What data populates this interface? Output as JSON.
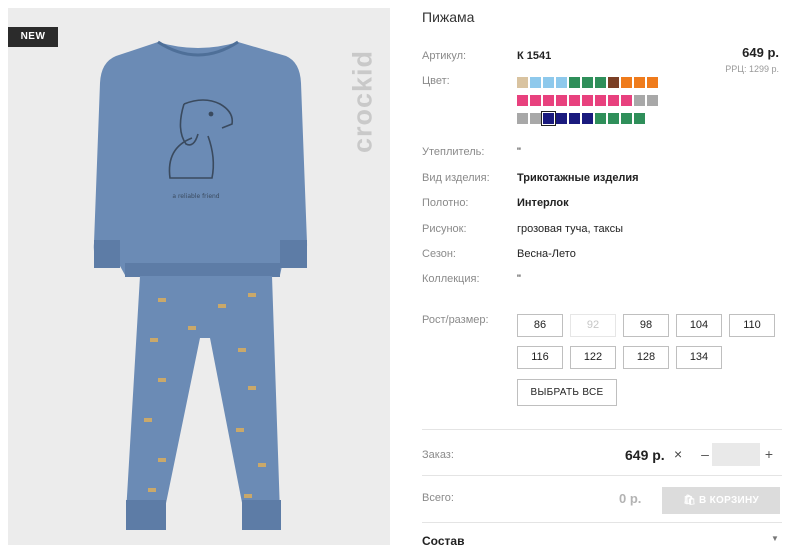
{
  "badge": "NEW",
  "brand": "crockid",
  "title": "Пижама",
  "article": {
    "label": "Артикул:",
    "value": "К 1541"
  },
  "price": {
    "value": "649 р.",
    "rrp": "РРЦ: 1299 р."
  },
  "color": {
    "label": "Цвет:",
    "swatches": [
      "#d9c3a0",
      "#8ec9ec",
      "#8ec9ec",
      "#8ec9ec",
      "#2f8f5a",
      "#2f8f5a",
      "#2f8f5a",
      "#7b3f25",
      "#ef7b1c",
      "#ef7b1c",
      "#ef7b1c",
      "#e8417e",
      "#e8417e",
      "#e8417e",
      "#e8417e",
      "#e8417e",
      "#e8417e",
      "#e8417e",
      "#e8417e",
      "#e8417e",
      "#a8a8a8",
      "#a8a8a8",
      "#a8a8a8",
      "#a8a8a8",
      "#1a1a7e",
      "#1a1a7e",
      "#1a1a7e",
      "#1a1a7e",
      "#2f8f5a",
      "#2f8f5a",
      "#2f8f5a",
      "#2f8f5a"
    ],
    "selected_index": 24
  },
  "props": [
    {
      "label": "Утеплитель:",
      "value": "\"",
      "bold": false
    },
    {
      "label": "Вид изделия:",
      "value": "Трикотажные изделия",
      "bold": true
    },
    {
      "label": "Полотно:",
      "value": "Интерлок",
      "bold": true
    },
    {
      "label": "Рисунок:",
      "value": "грозовая туча, таксы",
      "bold": false
    },
    {
      "label": "Сезон:",
      "value": "Весна-Лето",
      "bold": false
    },
    {
      "label": "Коллекция:",
      "value": "\"",
      "bold": false
    }
  ],
  "size": {
    "label": "Рост/размер:",
    "items": [
      {
        "label": "86",
        "disabled": false
      },
      {
        "label": "92",
        "disabled": true
      },
      {
        "label": "98",
        "disabled": false
      },
      {
        "label": "104",
        "disabled": false
      },
      {
        "label": "110",
        "disabled": false
      },
      {
        "label": "116",
        "disabled": false
      },
      {
        "label": "122",
        "disabled": false
      },
      {
        "label": "128",
        "disabled": false
      },
      {
        "label": "134",
        "disabled": false
      }
    ],
    "select_all": "ВЫБРАТЬ ВСЕ"
  },
  "order": {
    "label": "Заказ:",
    "price": "649 р.",
    "times": "×",
    "minus": "–",
    "plus": "+",
    "qty": ""
  },
  "total": {
    "label": "Всего:",
    "value": "0 р.",
    "cart_button": "В КОРЗИНУ"
  },
  "composition": {
    "label": "Состав"
  },
  "colors": {
    "product": "#6b8bb5",
    "product_dark": "#5d7ca6",
    "accent": "#2b2b2b"
  }
}
